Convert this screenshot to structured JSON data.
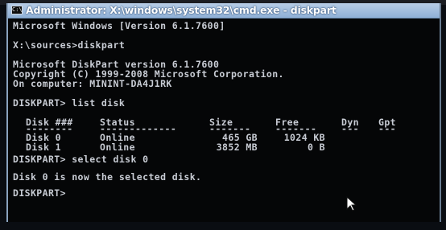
{
  "window": {
    "title": "Administrator: X:\\windows\\system32\\cmd.exe - diskpart",
    "icon_text": "C:\\"
  },
  "console": {
    "header": "Microsoft Windows [Version 6.1.7600]",
    "cmd_diskpart": "X:\\sources>diskpart",
    "diskpart_version": "Microsoft DiskPart version 6.1.7600",
    "copyright": "Copyright (C) 1999-2008 Microsoft Corporation.",
    "computer": "On computer: MININT-DA4J1RK",
    "cmd_list_disk": "DISKPART> list disk",
    "table": {
      "headers": [
        "Disk ###",
        "Status",
        "Size",
        "Free",
        "Dyn",
        "Gpt"
      ],
      "underline": [
        "--------",
        "-------------",
        "-------",
        "-------",
        "---",
        "---"
      ],
      "rows": [
        {
          "disk": "Disk 0",
          "status": "Online",
          "size": "465 GB",
          "free": "1024 KB",
          "dyn": "",
          "gpt": ""
        },
        {
          "disk": "Disk 1",
          "status": "Online",
          "size": "3852 MB",
          "free": "0 B",
          "dyn": "",
          "gpt": ""
        }
      ]
    },
    "cmd_select_disk": "DISKPART> select disk 0",
    "selected_message": "Disk 0 is now the selected disk.",
    "prompt": "DISKPART>"
  },
  "colors": {
    "console_bg": "#050607",
    "console_text": "#c8ccd4",
    "titlebar": "#a9c3e2"
  },
  "icons": {
    "window_icon": "cmd-icon",
    "mouse_pointer": "mouse-pointer-icon"
  }
}
